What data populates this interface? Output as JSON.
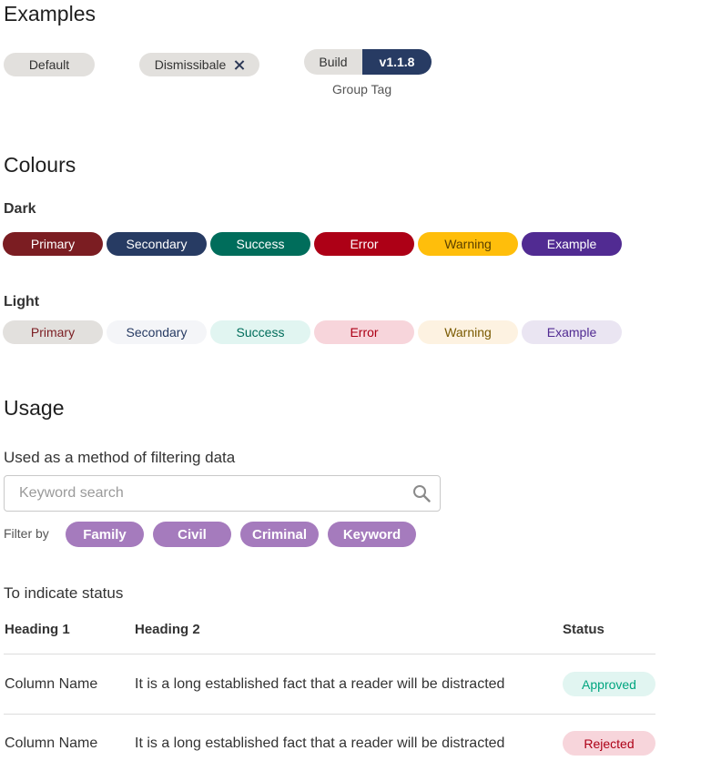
{
  "examples": {
    "heading": "Examples",
    "default_label": "Default",
    "dismissible_label": "Dismissibale",
    "group_left": "Build",
    "group_right": "v1.1.8",
    "group_caption": "Group Tag"
  },
  "colours": {
    "heading": "Colours",
    "dark_heading": "Dark",
    "light_heading": "Light",
    "dark": [
      {
        "label": "Primary",
        "bg": "#7b1d22",
        "fg": "#ffffff"
      },
      {
        "label": "Secondary",
        "bg": "#273b63",
        "fg": "#ffffff"
      },
      {
        "label": "Success",
        "bg": "#006d5b",
        "fg": "#ffffff"
      },
      {
        "label": "Error",
        "bg": "#ad0016",
        "fg": "#ffffff"
      },
      {
        "label": "Warning",
        "bg": "#ffbe0b",
        "fg": "#5a4000"
      },
      {
        "label": "Example",
        "bg": "#512b92",
        "fg": "#ffffff"
      }
    ],
    "light": [
      {
        "label": "Primary",
        "bg": "#e2e0dd",
        "fg": "#7b1d22"
      },
      {
        "label": "Secondary",
        "bg": "#f4f5f8",
        "fg": "#273b63"
      },
      {
        "label": "Success",
        "bg": "#e1f5f1",
        "fg": "#006d5b"
      },
      {
        "label": "Error",
        "bg": "#f7d5db",
        "fg": "#ad0016"
      },
      {
        "label": "Warning",
        "bg": "#fdf2e1",
        "fg": "#7a5a00"
      },
      {
        "label": "Example",
        "bg": "#eae5f2",
        "fg": "#512b92"
      }
    ]
  },
  "usage": {
    "heading": "Usage",
    "filter_text": "Used as a method of filtering data",
    "search_placeholder": "Keyword search",
    "search_icon": "search-icon",
    "filter_label": "Filter by",
    "chips": [
      "Family",
      "Civil",
      "Criminal",
      "Keyword"
    ],
    "status_text": "To indicate status"
  },
  "table": {
    "headers": [
      "Heading 1",
      "Heading 2",
      "Status"
    ],
    "rows": [
      {
        "col1": "Column Name",
        "col2": "It is a long established fact that a reader will be distracted",
        "status": "Approved",
        "status_bg": "#e1f5f1",
        "status_fg": "#00a57f"
      },
      {
        "col1": "Column Name",
        "col2": "It is a long established fact that a reader will be distracted",
        "status": "Rejected",
        "status_bg": "#f7d5db",
        "status_fg": "#ad0016"
      }
    ]
  }
}
